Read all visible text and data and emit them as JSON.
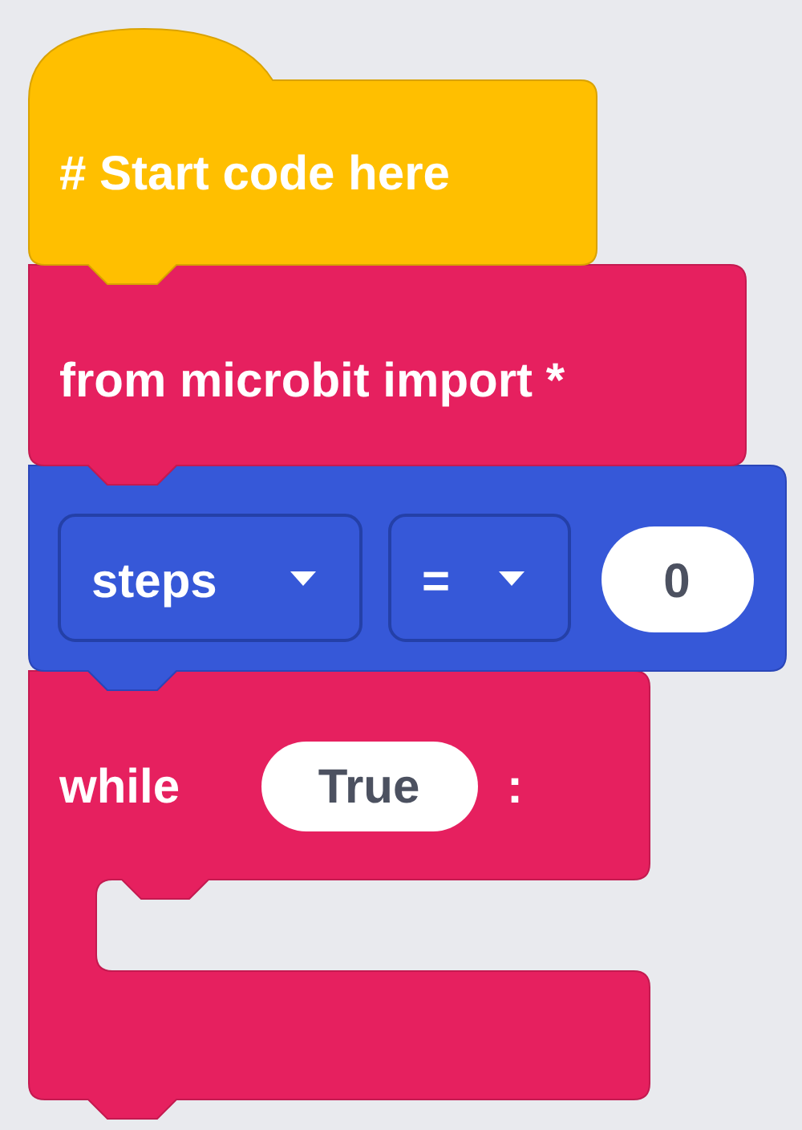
{
  "blocks": [
    {
      "kind": "hat",
      "text": "# Start code here"
    },
    {
      "kind": "statement",
      "text": "from microbit import *"
    },
    {
      "kind": "assign",
      "variable": "steps",
      "operator": "=",
      "value": "0"
    },
    {
      "kind": "while",
      "keyword": "while",
      "condition": "True",
      "suffix": ":"
    }
  ]
}
